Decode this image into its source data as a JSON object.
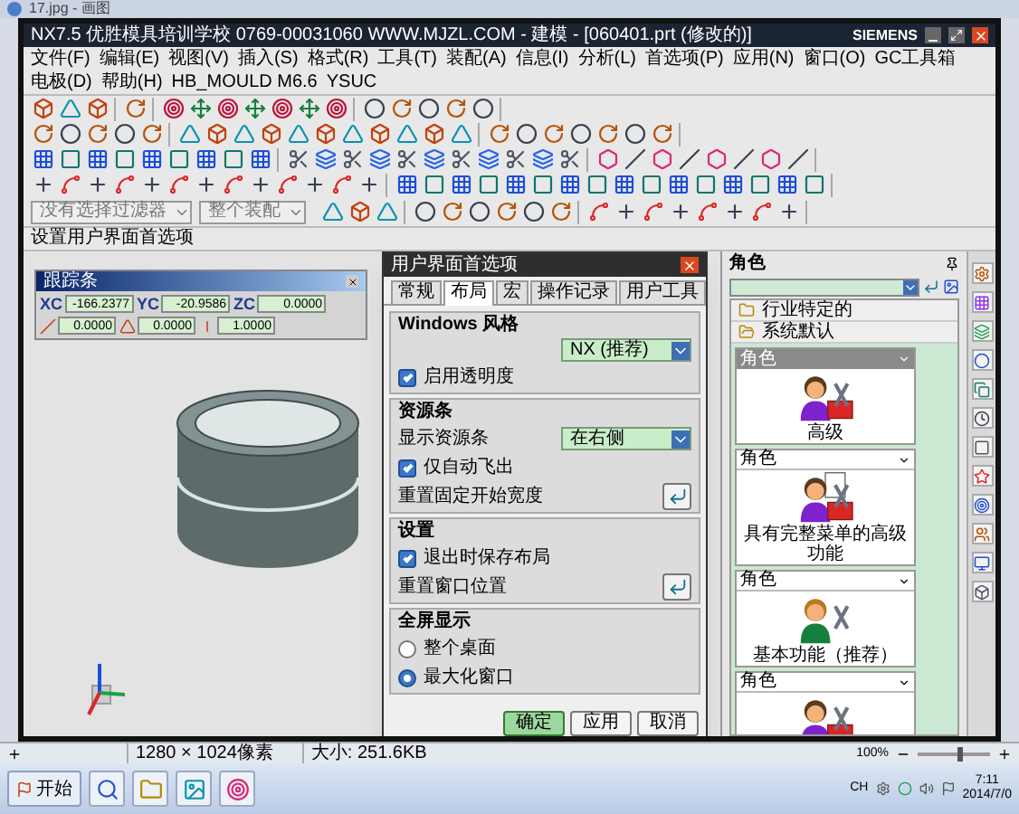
{
  "viewer": {
    "title": "17.jpg - 画图"
  },
  "window": {
    "title": "NX7.5  优胜模具培训学校  0769-00031060  WWW.MJZL.COM - 建模 - [060401.prt (修改的)]",
    "brand": "SIEMENS"
  },
  "menu": [
    "文件(F)",
    "编辑(E)",
    "视图(V)",
    "插入(S)",
    "格式(R)",
    "工具(T)",
    "装配(A)",
    "信息(I)",
    "分析(L)",
    "首选项(P)",
    "应用(N)",
    "窗口(O)",
    "GC工具箱",
    "电极(D)",
    "帮助(H)",
    "HB_MOULD M6.6",
    "YSUC"
  ],
  "filters": [
    {
      "value": "没有选择过滤器"
    },
    {
      "value": "整个装配"
    }
  ],
  "cue_line": "设置用户界面首选项",
  "tracking_bar": {
    "title": "跟踪条",
    "fields": [
      {
        "kind": "coord",
        "label": "XC",
        "value": "-166.2377"
      },
      {
        "kind": "coord",
        "label": "YC",
        "value": "-20.9586"
      },
      {
        "kind": "coord",
        "label": "ZC",
        "value": "0.0000"
      },
      {
        "kind": "length",
        "value": "0.0000"
      },
      {
        "kind": "angle",
        "value": "0.0000"
      },
      {
        "kind": "offset",
        "value": "1.0000"
      }
    ]
  },
  "dialog": {
    "title": "用户界面首选项",
    "tabs": [
      {
        "label": "常规",
        "selected": false
      },
      {
        "label": "布局",
        "selected": true
      },
      {
        "label": "宏",
        "selected": false
      },
      {
        "label": "操作记录",
        "selected": false
      },
      {
        "label": "用户工具",
        "selected": false
      }
    ],
    "groups": [
      {
        "title": "Windows 风格",
        "rows": [
          {
            "kind": "select",
            "value": "NX (推荐)"
          },
          {
            "kind": "checkbox",
            "label": "启用透明度",
            "checked": true
          }
        ]
      },
      {
        "title": "资源条",
        "rows": [
          {
            "kind": "select",
            "label": "显示资源条",
            "value": "在右侧"
          },
          {
            "kind": "checkbox",
            "label": "仅自动飞出",
            "checked": true
          },
          {
            "kind": "button",
            "label": "重置固定开始宽度"
          }
        ]
      },
      {
        "title": "设置",
        "rows": [
          {
            "kind": "checkbox",
            "label": "退出时保存布局",
            "checked": true
          },
          {
            "kind": "button",
            "label": "重置窗口位置"
          }
        ]
      },
      {
        "title": "全屏显示",
        "rows": [
          {
            "kind": "radio",
            "label": "整个桌面",
            "selected": false
          },
          {
            "kind": "radio",
            "label": "最大化窗口",
            "selected": true
          }
        ]
      }
    ],
    "buttons": [
      {
        "label": "确定",
        "default": true
      },
      {
        "label": "应用",
        "default": false
      },
      {
        "label": "取消",
        "default": false
      }
    ]
  },
  "resource": {
    "title": "角色",
    "folders": [
      {
        "label": "行业特定的",
        "expanded": false
      },
      {
        "label": "系统默认",
        "expanded": true
      }
    ],
    "cards": [
      {
        "header": "角色",
        "caption": "高级",
        "selected": true,
        "kind": "advanced"
      },
      {
        "header": "角色",
        "caption": "具有完整菜单的高级功能",
        "selected": false,
        "kind": "menus"
      },
      {
        "header": "角色",
        "caption": "基本功能（推荐）",
        "selected": false,
        "kind": "essentials"
      },
      {
        "header": "角色",
        "selected": false,
        "kind": "partial"
      }
    ]
  },
  "status_bar": {
    "items": [
      "1280 × 1024像素",
      "大小: 251.6KB"
    ],
    "zoom": "100%",
    "level": 0.6
  },
  "taskbar": {
    "start": "开始",
    "language": "CH",
    "time": "7:11",
    "date": "2014/7/0"
  }
}
